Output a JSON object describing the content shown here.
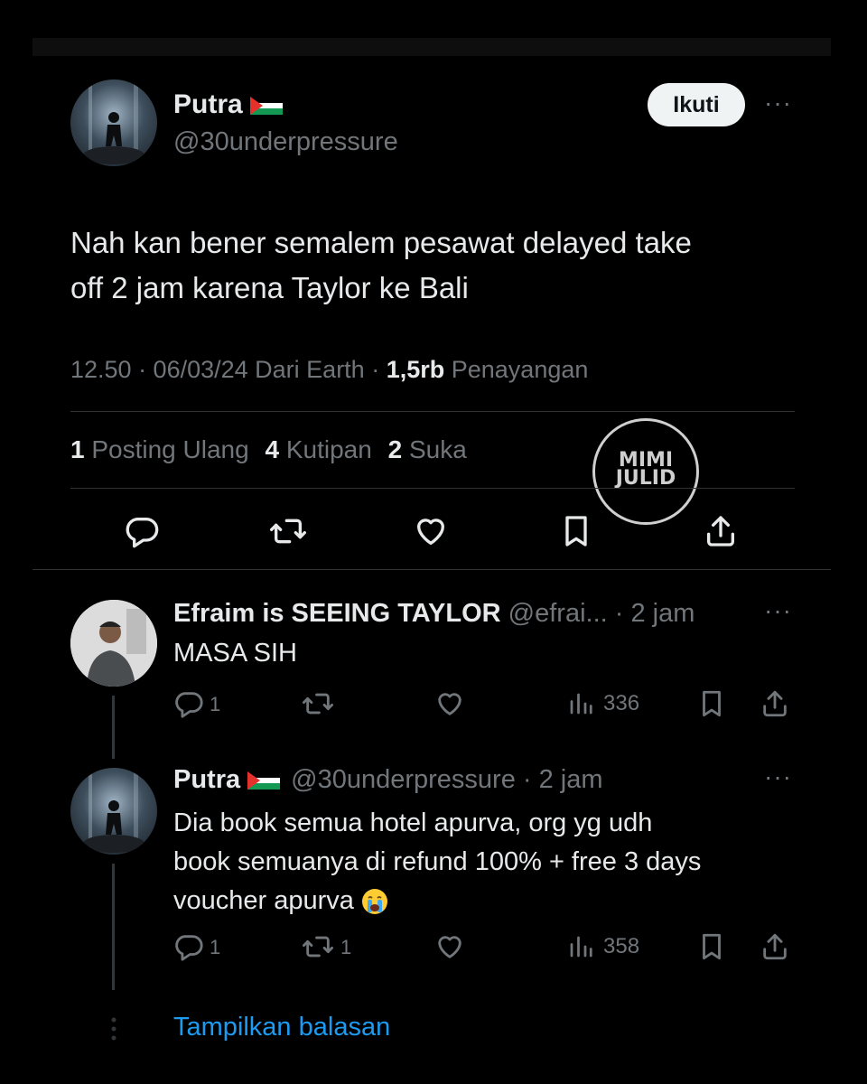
{
  "main_tweet": {
    "display_name": "Putra",
    "handle": "@30underpressure",
    "follow_label": "Ikuti",
    "text_line1": "Nah kan bener semalem pesawat delayed take",
    "text_line2": "off 2 jam karena Taylor ke Bali",
    "meta_time": "12.50 · 06/03/24 Dari Earth · ",
    "meta_views_count": "1,5rb",
    "meta_views_label": " Penayangan",
    "stats": {
      "repost_count": "1",
      "repost_label": "Posting Ulang",
      "quote_count": "4",
      "quote_label": "Kutipan",
      "like_count": "2",
      "like_label": "Suka"
    }
  },
  "watermark": {
    "line1": "MIMI",
    "line2": "JULID"
  },
  "replies": [
    {
      "display_name": "Efraim is SEEING TAYLOR",
      "handle_time": "@efrai... · 2 jam",
      "text": "MASA SIH",
      "reply_count": "1",
      "repost_count": "",
      "views": "336"
    },
    {
      "display_name": "Putra",
      "handle_time": "@30underpressure · 2 jam",
      "text_line1": "Dia book semua hotel apurva, org yg udh",
      "text_line2": "book semuanya di refund 100% + free 3 days",
      "text_line3": "voucher apurva",
      "reply_count": "1",
      "repost_count": "1",
      "views": "358"
    }
  ],
  "show_replies_label": "Tampilkan balasan",
  "colors": {
    "background": "#000000",
    "text": "#e7e9ea",
    "muted": "#71767b",
    "link": "#1d9bf0",
    "divider": "#2f3336"
  }
}
